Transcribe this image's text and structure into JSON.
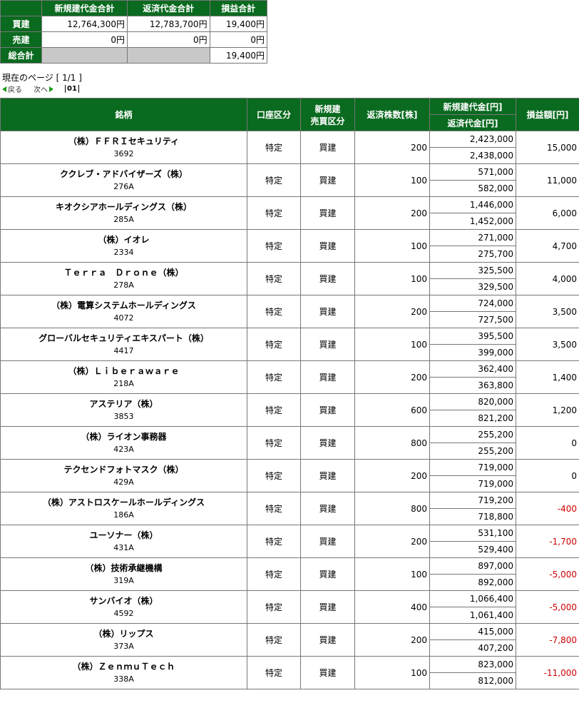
{
  "summary": {
    "headers": [
      "新規建代金合計",
      "返済代金合計",
      "損益合計"
    ],
    "rows": [
      {
        "label": "買建",
        "new": "12,764,300円",
        "ret": "12,783,700円",
        "pl": "19,400円"
      },
      {
        "label": "売建",
        "new": "0円",
        "ret": "0円",
        "pl": "0円"
      }
    ],
    "total": {
      "label": "総合計",
      "pl": "19,400円"
    }
  },
  "page_info": "現在のページ [ 1/1 ]",
  "pager": {
    "prev": "戻る",
    "next": "次へ",
    "current": "01"
  },
  "table": {
    "headers": {
      "name": "銘柄",
      "account": "口座区分",
      "trade_line1": "新規建",
      "trade_line2": "売買区分",
      "qty": "返済株数[株]",
      "new_amount": "新規建代金[円]",
      "ret_amount": "返済代金[円]",
      "pl": "損益額[円]"
    },
    "rows": [
      {
        "name": "（株）ＦＦＲＩセキュリティ",
        "code": "3692",
        "account": "特定",
        "trade": "買建",
        "qty": "200",
        "new": "2,423,000",
        "ret": "2,438,000",
        "pl": "15,000",
        "neg": false
      },
      {
        "name": "ククレブ・アドバイザーズ（株）",
        "code": "276A",
        "account": "特定",
        "trade": "買建",
        "qty": "100",
        "new": "571,000",
        "ret": "582,000",
        "pl": "11,000",
        "neg": false
      },
      {
        "name": "キオクシアホールディングス（株）",
        "code": "285A",
        "account": "特定",
        "trade": "買建",
        "qty": "200",
        "new": "1,446,000",
        "ret": "1,452,000",
        "pl": "6,000",
        "neg": false
      },
      {
        "name": "（株）イオレ",
        "code": "2334",
        "account": "特定",
        "trade": "買建",
        "qty": "100",
        "new": "271,000",
        "ret": "275,700",
        "pl": "4,700",
        "neg": false
      },
      {
        "name": "Ｔｅｒｒａ　Ｄｒｏｎｅ（株）",
        "code": "278A",
        "account": "特定",
        "trade": "買建",
        "qty": "100",
        "new": "325,500",
        "ret": "329,500",
        "pl": "4,000",
        "neg": false
      },
      {
        "name": "（株）電算システムホールディングス",
        "code": "4072",
        "account": "特定",
        "trade": "買建",
        "qty": "200",
        "new": "724,000",
        "ret": "727,500",
        "pl": "3,500",
        "neg": false
      },
      {
        "name": "グローバルセキュリティエキスパート（株）",
        "code": "4417",
        "account": "特定",
        "trade": "買建",
        "qty": "100",
        "new": "395,500",
        "ret": "399,000",
        "pl": "3,500",
        "neg": false
      },
      {
        "name": "（株）Ｌｉｂｅｒａｗａｒｅ",
        "code": "218A",
        "account": "特定",
        "trade": "買建",
        "qty": "200",
        "new": "362,400",
        "ret": "363,800",
        "pl": "1,400",
        "neg": false
      },
      {
        "name": "アステリア（株）",
        "code": "3853",
        "account": "特定",
        "trade": "買建",
        "qty": "600",
        "new": "820,000",
        "ret": "821,200",
        "pl": "1,200",
        "neg": false
      },
      {
        "name": "（株）ライオン事務器",
        "code": "423A",
        "account": "特定",
        "trade": "買建",
        "qty": "800",
        "new": "255,200",
        "ret": "255,200",
        "pl": "0",
        "neg": false
      },
      {
        "name": "テクセンドフォトマスク（株）",
        "code": "429A",
        "account": "特定",
        "trade": "買建",
        "qty": "200",
        "new": "719,000",
        "ret": "719,000",
        "pl": "0",
        "neg": false
      },
      {
        "name": "（株）アストロスケールホールディングス",
        "code": "186A",
        "account": "特定",
        "trade": "買建",
        "qty": "800",
        "new": "719,200",
        "ret": "718,800",
        "pl": "-400",
        "neg": true
      },
      {
        "name": "ユーソナー（株）",
        "code": "431A",
        "account": "特定",
        "trade": "買建",
        "qty": "200",
        "new": "531,100",
        "ret": "529,400",
        "pl": "-1,700",
        "neg": true
      },
      {
        "name": "（株）技術承継機構",
        "code": "319A",
        "account": "特定",
        "trade": "買建",
        "qty": "100",
        "new": "897,000",
        "ret": "892,000",
        "pl": "-5,000",
        "neg": true
      },
      {
        "name": "サンバイオ（株）",
        "code": "4592",
        "account": "特定",
        "trade": "買建",
        "qty": "400",
        "new": "1,066,400",
        "ret": "1,061,400",
        "pl": "-5,000",
        "neg": true
      },
      {
        "name": "（株）リップス",
        "code": "373A",
        "account": "特定",
        "trade": "買建",
        "qty": "200",
        "new": "415,000",
        "ret": "407,200",
        "pl": "-7,800",
        "neg": true
      },
      {
        "name": "（株）ＺｅｎｍｕＴｅｃｈ",
        "code": "338A",
        "account": "特定",
        "trade": "買建",
        "qty": "100",
        "new": "823,000",
        "ret": "812,000",
        "pl": "-11,000",
        "neg": true
      }
    ]
  },
  "colors": {
    "header_bg": "#0a6a1f",
    "negative": "#d00000",
    "pager_arrow": "#1a9a1a"
  }
}
